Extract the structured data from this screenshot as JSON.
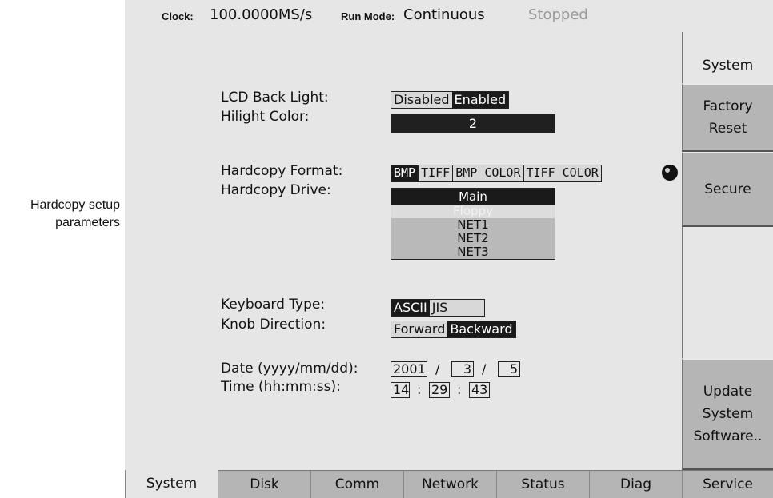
{
  "status_bar": {
    "clock_label": "Clock:",
    "clock_value": "100.0000MS/s",
    "run_mode_label": "Run Mode:",
    "run_mode_value": "Continuous",
    "state": "Stopped"
  },
  "settings": {
    "lcd_back_light": {
      "label": "LCD Back Light:",
      "options": [
        "Disabled",
        "Enabled"
      ],
      "selected": "Enabled"
    },
    "hilight_color": {
      "label": "Hilight Color:",
      "value": "2"
    },
    "hardcopy_format": {
      "label": "Hardcopy Format:",
      "options": [
        "BMP",
        "TIFF",
        "BMP COLOR",
        "TIFF COLOR"
      ],
      "selected": "BMP"
    },
    "hardcopy_drive": {
      "label": "Hardcopy Drive:",
      "options": [
        "Main",
        "Floppy",
        "NET1",
        "NET2",
        "NET3"
      ],
      "selected": "Main",
      "disabled": [
        "Floppy"
      ]
    },
    "keyboard_type": {
      "label": "Keyboard Type:",
      "options": [
        "ASCII",
        "JIS"
      ],
      "selected": "ASCII"
    },
    "knob_direction": {
      "label": "Knob Direction:",
      "options": [
        "Forward",
        "Backward"
      ],
      "selected": "Backward"
    },
    "date": {
      "label": "Date (yyyy/mm/dd):",
      "year": "2001",
      "month": "3",
      "day": "5",
      "sep": "/"
    },
    "time": {
      "label": "Time (hh:mm:ss):",
      "hour": "14",
      "minute": "29",
      "second": "43",
      "sep": ":"
    }
  },
  "side_menu": {
    "system": "System",
    "factory_reset": [
      "Factory",
      "Reset"
    ],
    "secure": "Secure",
    "update_system_software": [
      "Update",
      "System",
      "Software.."
    ]
  },
  "bottom_tabs": [
    "System",
    "Disk",
    "Comm",
    "Network",
    "Status",
    "Diag",
    "Service"
  ],
  "callout": {
    "line1": "Hardcopy setup",
    "line2": "parameters"
  },
  "colors": {
    "panel": "#e6e6e6",
    "button": "#b5b5b5",
    "selected": "#1a1a1a"
  }
}
